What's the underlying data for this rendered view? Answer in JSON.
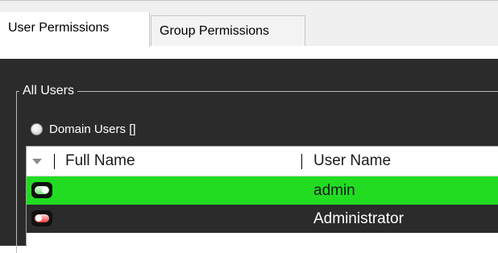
{
  "tabs": [
    {
      "label": "User Permissions",
      "active": true
    },
    {
      "label": "Group Permissions",
      "active": false
    }
  ],
  "groupbox": {
    "title": "All Users"
  },
  "radio": {
    "label": "Domain Users []"
  },
  "grid": {
    "columns": [
      "Full Name",
      "User Name"
    ],
    "rows": [
      {
        "status_icon": "enabled-toggle-icon",
        "full_name": "",
        "user_name": "admin",
        "selected": true
      },
      {
        "status_icon": "disabled-toggle-icon",
        "full_name": "",
        "user_name": "Administrator",
        "selected": false
      }
    ]
  },
  "colors": {
    "selected_row": "#22dc22",
    "panel_background": "#2b2b2b",
    "enabled_icon": "#7fe07f",
    "disabled_icon": "#ff3a3a"
  }
}
